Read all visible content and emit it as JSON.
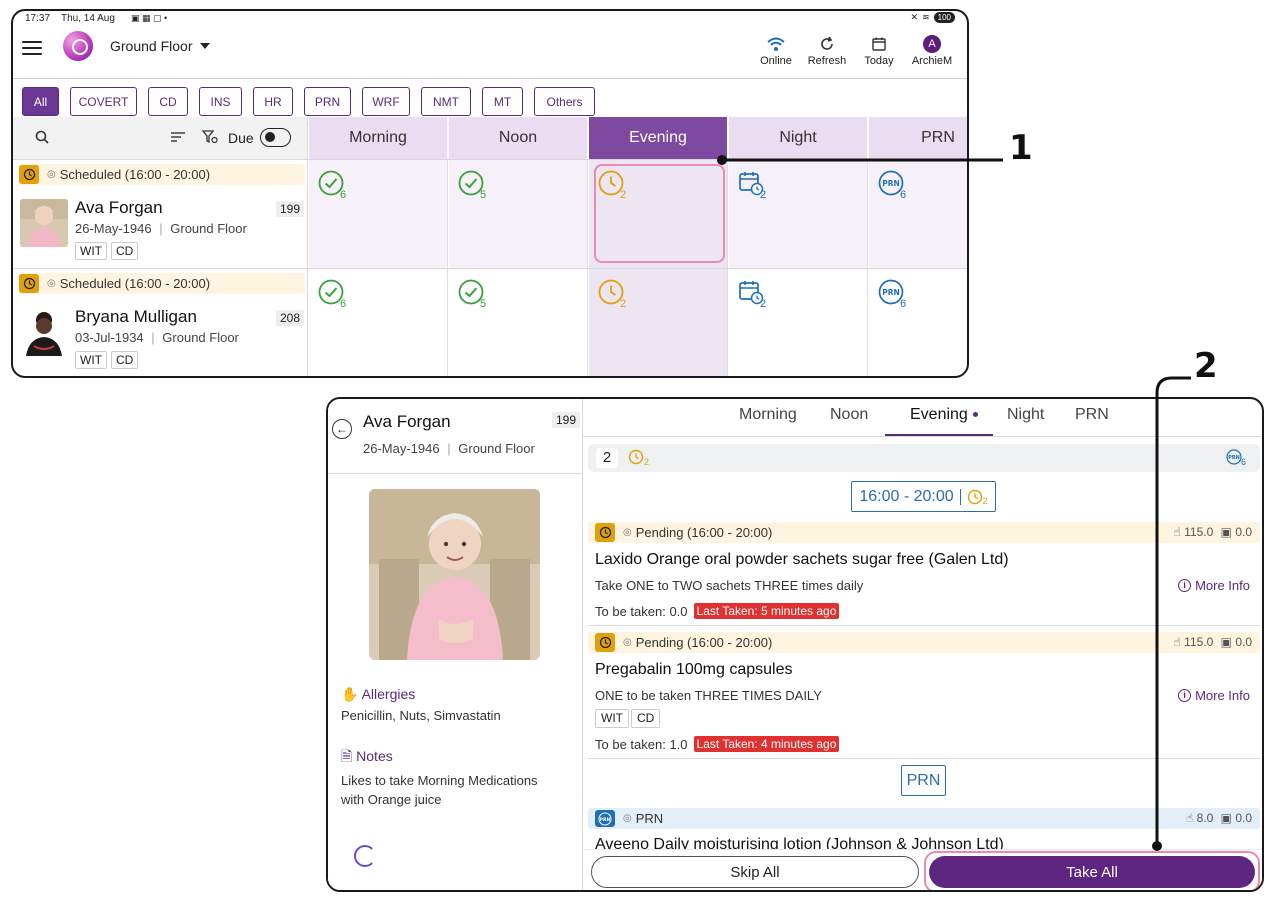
{
  "status_bar": {
    "time": "17:37",
    "date": "Thu, 14 Aug",
    "battery": "100"
  },
  "header": {
    "floor": "Ground Floor",
    "actions": [
      {
        "label": "Online",
        "icon": "wifi-icon"
      },
      {
        "label": "Refresh",
        "icon": "refresh-icon"
      },
      {
        "label": "Today",
        "icon": "calendar-icon"
      },
      {
        "label": "ArchieM",
        "icon": "user-avatar",
        "initial": "A"
      }
    ]
  },
  "filters": [
    "All",
    "COVERT",
    "CD",
    "INS",
    "HR",
    "PRN",
    "WRF",
    "NMT",
    "MT",
    "Others"
  ],
  "grid": {
    "due_label": "Due",
    "columns": [
      "Morning",
      "Noon",
      "Evening",
      "Night",
      "PRN"
    ],
    "rows": [
      {
        "schedule": "Scheduled (16:00 - 20:00)",
        "name": "Ava Forgan",
        "dob": "26-May-1946",
        "floor": "Ground Floor",
        "room": "199",
        "tags": [
          "WIT",
          "CD"
        ],
        "cells": [
          {
            "status": "done",
            "count": "6"
          },
          {
            "status": "done",
            "count": "5"
          },
          {
            "status": "pending",
            "count": "2"
          },
          {
            "status": "scheduled",
            "count": "2"
          },
          {
            "status": "prn",
            "count": "6"
          }
        ]
      },
      {
        "schedule": "Scheduled (16:00 - 20:00)",
        "name": "Bryana Mulligan",
        "dob": "03-Jul-1934",
        "floor": "Ground Floor",
        "room": "208",
        "tags": [
          "WIT",
          "CD"
        ],
        "cells": [
          {
            "status": "done",
            "count": "6"
          },
          {
            "status": "done",
            "count": "5"
          },
          {
            "status": "pending",
            "count": "2"
          },
          {
            "status": "scheduled",
            "count": "2"
          },
          {
            "status": "prn",
            "count": "6"
          }
        ]
      }
    ]
  },
  "detail": {
    "name": "Ava Forgan",
    "dob": "26-May-1946",
    "floor": "Ground Floor",
    "room": "199",
    "allergies_title": "Allergies",
    "allergies": "Penicillin, Nuts, Simvastatin",
    "notes_title": "Notes",
    "notes_line1": "Likes to take Morning Medications",
    "notes_line2": "with Orange juice",
    "tabs": [
      "Morning",
      "Noon",
      "Evening",
      "Night",
      "PRN"
    ],
    "active_tab": "Evening",
    "summary_count": "2",
    "summary_pending": "2",
    "summary_prn": "6",
    "timeslot": "16:00 - 20:00",
    "timeslot_count": "2",
    "prn_section": "PRN",
    "prn_badge": "PRN",
    "medications": [
      {
        "status": "Pending (16:00 - 20:00)",
        "stock_a": "115.0",
        "stock_b": "0.0",
        "name": "Laxido Orange oral powder sachets sugar free (Galen Ltd)",
        "directions": "Take ONE to TWO sachets THREE times daily",
        "more_info": "More Info",
        "to_be_taken": "To be taken: 0.0",
        "last_taken": "Last Taken: 5 minutes ago"
      },
      {
        "status": "Pending (16:00 - 20:00)",
        "stock_a": "115.0",
        "stock_b": "0.0",
        "name": "Pregabalin 100mg capsules",
        "directions": "ONE to be taken THREE TIMES DAILY",
        "tags": [
          "WIT",
          "CD"
        ],
        "more_info": "More Info",
        "to_be_taken": "To be taken: 1.0",
        "last_taken": "Last Taken: 4 minutes ago"
      },
      {
        "status": "PRN",
        "stock_a": "8.0",
        "stock_b": "0.0",
        "name": "Aveeno Daily moisturising lotion (Johnson & Johnson Ltd)"
      }
    ],
    "skip_all": "Skip All",
    "take_all": "Take All"
  },
  "callouts": [
    "1",
    "2"
  ],
  "colors": {
    "brand_purple": "#5e2680",
    "active_column": "#7e4aa0",
    "pending_amber": "#e0a10a",
    "done_green": "#3aa03a",
    "scheduled_blue": "#1f6fb8",
    "last_taken_red": "#e03131",
    "highlight_pink": "#e98ab0"
  }
}
